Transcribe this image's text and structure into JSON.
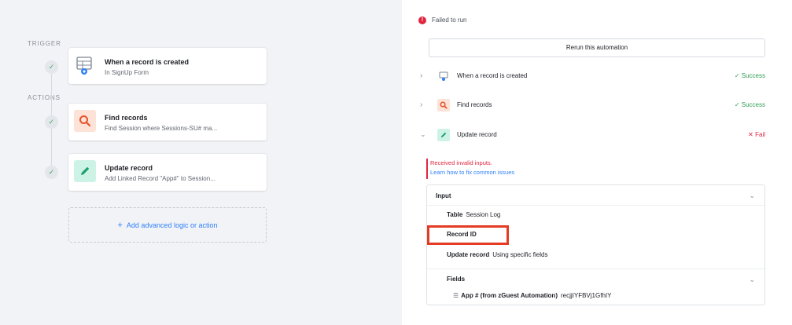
{
  "left": {
    "trigger_label": "TRIGGER",
    "actions_label": "ACTIONS",
    "trigger_step": {
      "title": "When a record is created",
      "subtitle": "In SignUp Form",
      "icon": "table-plus-icon"
    },
    "action_steps": [
      {
        "title": "Find records",
        "subtitle": "Find Session where Sessions-SU# ma...",
        "icon": "search-icon",
        "color": "#fde2d7"
      },
      {
        "title": "Update record",
        "subtitle": "Add Linked Record \"App#\" to Session...",
        "icon": "pencil-icon",
        "color": "#cdf3e6"
      }
    ],
    "add_action": "Add advanced logic or action",
    "add_plus": "+"
  },
  "right": {
    "status": "Failed to run",
    "rerun_button": "Rerun this automation",
    "runs": [
      {
        "label": "When a record is created",
        "status": "Success",
        "state": "ok",
        "icon": "form-icon"
      },
      {
        "label": "Find records",
        "status": "Success",
        "state": "ok",
        "icon": "search-icon"
      },
      {
        "label": "Update record",
        "status": "Fail",
        "state": "fail",
        "icon": "pencil-icon"
      }
    ],
    "error_message": "Received invalid inputs.",
    "error_link": "Learn how to fix common issues",
    "input": {
      "header": "Input",
      "table_key": "Table",
      "table_value": "Session Log",
      "record_id_key": "Record ID",
      "update_key": "Update record",
      "update_value": "Using specific fields",
      "fields_header": "Fields",
      "field_name": "App # (from zGuest Automation)",
      "field_value": "recjjIYFBVj1GfhIY"
    }
  },
  "colors": {
    "accent_blue": "#2d7ff9",
    "success_green": "#2f9e55",
    "fail_red": "#e0253f",
    "highlight_red": "#e53a23"
  }
}
